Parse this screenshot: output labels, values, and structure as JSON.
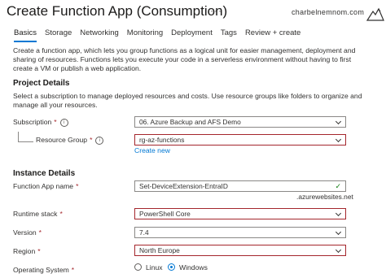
{
  "page": {
    "title": "Create Function App (Consumption)",
    "more": "···"
  },
  "watermark": {
    "text": "charbelnemnom.com"
  },
  "tabs": [
    {
      "label": "Basics",
      "active": true
    },
    {
      "label": "Storage"
    },
    {
      "label": "Networking"
    },
    {
      "label": "Monitoring"
    },
    {
      "label": "Deployment"
    },
    {
      "label": "Tags"
    },
    {
      "label": "Review + create"
    }
  ],
  "intro": "Create a function app, which lets you group functions as a logical unit for easier management, deployment and sharing of resources. Functions lets you execute your code in a serverless environment without having to first create a VM or publish a web application.",
  "project": {
    "heading": "Project Details",
    "description": "Select a subscription to manage deployed resources and costs. Use resource groups like folders to organize and manage all your resources.",
    "subscription_label": "Subscription",
    "subscription_value": "06. Azure Backup and AFS Demo",
    "resource_group_label": "Resource Group",
    "resource_group_value": "rg-az-functions",
    "create_new": "Create new"
  },
  "instance": {
    "heading": "Instance Details",
    "app_name_label": "Function App name",
    "app_name_value": "Set-DeviceExtension-EntraID",
    "app_name_suffix": ".azurewebsites.net",
    "runtime_label": "Runtime stack",
    "runtime_value": "PowerShell Core",
    "version_label": "Version",
    "version_value": "7.4",
    "region_label": "Region",
    "region_value": "North Europe",
    "os_label": "Operating System",
    "os_options": [
      "Linux",
      "Windows"
    ],
    "os_selected": "Windows"
  },
  "required_mark": "*"
}
